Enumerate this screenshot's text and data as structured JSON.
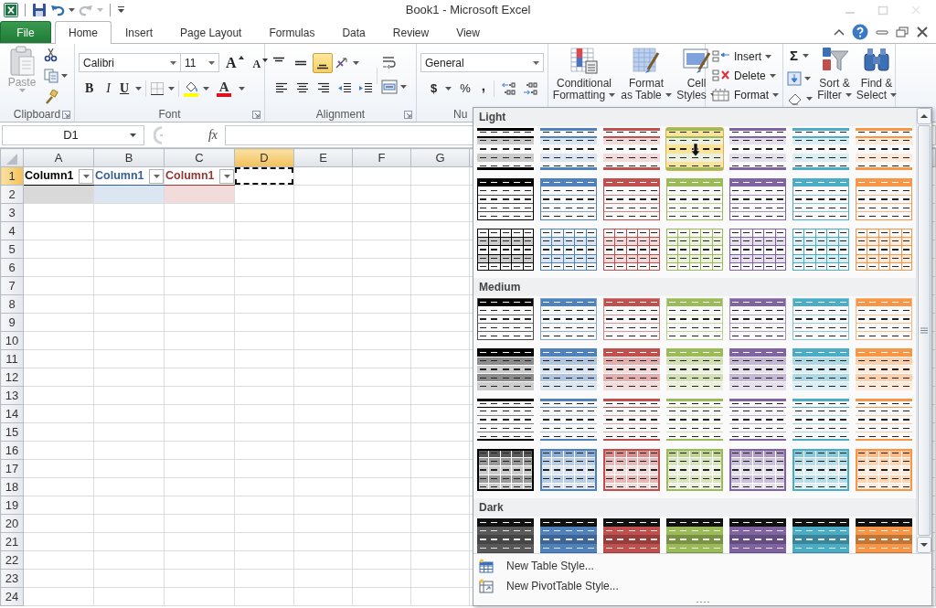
{
  "window": {
    "title": "Book1 - Microsoft Excel"
  },
  "quick_access": [
    {
      "kind": "save",
      "disabled": false
    },
    {
      "kind": "undo",
      "disabled": false
    },
    {
      "kind": "redo",
      "disabled": true
    }
  ],
  "file_tab": {
    "label": "File"
  },
  "tabs": [
    {
      "label": "Home",
      "selected": true
    },
    {
      "label": "Insert",
      "selected": false
    },
    {
      "label": "Page Layout",
      "selected": false
    },
    {
      "label": "Formulas",
      "selected": false
    },
    {
      "label": "Data",
      "selected": false
    },
    {
      "label": "Review",
      "selected": false
    },
    {
      "label": "View",
      "selected": false
    }
  ],
  "ribbon": {
    "clipboard": {
      "label": "Clipboard",
      "paste": {
        "label": "Paste",
        "disabled": true
      }
    },
    "font": {
      "label": "Font",
      "name": "Calibri",
      "size": "11",
      "grow": "A",
      "shrink": "A",
      "bold": "B",
      "italic": "I",
      "underline": "U",
      "color_letter": "A"
    },
    "alignment": {
      "label": "Alignment",
      "vertical": [
        {
          "kind": "top",
          "selected": false
        },
        {
          "kind": "middle",
          "selected": false
        },
        {
          "kind": "bottom",
          "selected": true
        }
      ]
    },
    "number": {
      "label": "Nu",
      "format": "General",
      "currency": "$",
      "percent": "%",
      "comma": ","
    },
    "styles": [
      {
        "kind": "conditional",
        "lines": [
          "Conditional",
          "Formatting"
        ]
      },
      {
        "kind": "table",
        "lines": [
          "Format",
          "as Table"
        ]
      },
      {
        "kind": "cell",
        "lines": [
          "Cell",
          "Styles"
        ]
      }
    ],
    "cells": [
      {
        "kind": "insert",
        "label": "Insert"
      },
      {
        "kind": "delete",
        "label": "Delete"
      },
      {
        "kind": "format",
        "label": "Format"
      }
    ],
    "editing": {
      "sum": "Σ",
      "buttons": [
        {
          "kind": "sort",
          "lines": [
            "Sort &",
            "Filter"
          ]
        },
        {
          "kind": "find",
          "lines": [
            "Find &",
            "Select"
          ]
        }
      ]
    }
  },
  "formula_bar": {
    "name_box": "D1",
    "fx": "fx"
  },
  "sheet": {
    "columns": [
      {
        "label": "A",
        "selected": false
      },
      {
        "label": "B",
        "selected": false
      },
      {
        "label": "C",
        "selected": false
      },
      {
        "label": "D",
        "selected": true
      },
      {
        "label": "E",
        "selected": false
      },
      {
        "label": "F",
        "selected": false
      },
      {
        "label": "G",
        "selected": false
      }
    ],
    "rows": [
      {
        "label": "1",
        "selected": true,
        "cells": [
          {
            "kind": "table-header",
            "text": "Column1",
            "color": "#000000"
          },
          {
            "kind": "table-header",
            "text": "Column1",
            "color": "#366092"
          },
          {
            "kind": "table-header",
            "text": "Column1",
            "color": "#963634"
          },
          {
            "kind": "active"
          }
        ]
      },
      {
        "label": "2",
        "selected": false,
        "cells": [
          {
            "kind": "table-body",
            "color": "#d9d9d9"
          },
          {
            "kind": "table-body",
            "color": "#dce6f1"
          },
          {
            "kind": "table-body",
            "color": "#f2dcdb"
          }
        ]
      },
      {
        "label": "3",
        "selected": false
      },
      {
        "label": "4",
        "selected": false
      },
      {
        "label": "5",
        "selected": false
      },
      {
        "label": "6",
        "selected": false
      },
      {
        "label": "7",
        "selected": false
      },
      {
        "label": "8",
        "selected": false
      },
      {
        "label": "9",
        "selected": false
      },
      {
        "label": "10",
        "selected": false
      },
      {
        "label": "11",
        "selected": false
      },
      {
        "label": "12",
        "selected": false
      },
      {
        "label": "13",
        "selected": false
      },
      {
        "label": "14",
        "selected": false
      },
      {
        "label": "15",
        "selected": false
      },
      {
        "label": "16",
        "selected": false
      },
      {
        "label": "17",
        "selected": false
      },
      {
        "label": "18",
        "selected": false
      },
      {
        "label": "19",
        "selected": false
      },
      {
        "label": "20",
        "selected": false
      },
      {
        "label": "21",
        "selected": false
      },
      {
        "label": "22",
        "selected": false
      },
      {
        "label": "23",
        "selected": false
      },
      {
        "label": "24",
        "selected": false
      }
    ]
  },
  "gallery": {
    "sections": [
      {
        "title": "Light",
        "rows": [
          {
            "kind": "light-banded",
            "items": [
              {
                "color": "#000000",
                "highlighted": false
              },
              {
                "color": "#4f81bd",
                "highlighted": false
              },
              {
                "color": "#c0504d",
                "highlighted": false
              },
              {
                "color": "#9bbb59",
                "highlighted": true
              },
              {
                "color": "#8064a2",
                "highlighted": false
              },
              {
                "color": "#4bacc6",
                "highlighted": false
              },
              {
                "color": "#f79646",
                "highlighted": false
              }
            ]
          },
          {
            "kind": "light-header",
            "items": [
              {
                "color": "#000000",
                "highlighted": false
              },
              {
                "color": "#4f81bd",
                "highlighted": false
              },
              {
                "color": "#c0504d",
                "highlighted": false
              },
              {
                "color": "#9bbb59",
                "highlighted": false
              },
              {
                "color": "#8064a2",
                "highlighted": false
              },
              {
                "color": "#4bacc6",
                "highlighted": false
              },
              {
                "color": "#f79646",
                "highlighted": false
              }
            ]
          },
          {
            "kind": "light-grid",
            "items": [
              {
                "color": "#000000",
                "highlighted": false
              },
              {
                "color": "#4f81bd",
                "highlighted": false
              },
              {
                "color": "#c0504d",
                "highlighted": false
              },
              {
                "color": "#9bbb59",
                "highlighted": false
              },
              {
                "color": "#8064a2",
                "highlighted": false
              },
              {
                "color": "#4bacc6",
                "highlighted": false
              },
              {
                "color": "#f79646",
                "highlighted": false
              }
            ]
          }
        ]
      },
      {
        "title": "Medium",
        "rows": [
          {
            "kind": "medium-lined",
            "items": [
              {
                "color": "#000000",
                "highlighted": false
              },
              {
                "color": "#4f81bd",
                "highlighted": false
              },
              {
                "color": "#c0504d",
                "highlighted": false
              },
              {
                "color": "#9bbb59",
                "highlighted": false
              },
              {
                "color": "#8064a2",
                "highlighted": false
              },
              {
                "color": "#4bacc6",
                "highlighted": false
              },
              {
                "color": "#f79646",
                "highlighted": false
              }
            ]
          },
          {
            "kind": "medium-banded",
            "items": [
              {
                "color": "#000000",
                "highlighted": false
              },
              {
                "color": "#4f81bd",
                "highlighted": false
              },
              {
                "color": "#c0504d",
                "highlighted": false
              },
              {
                "color": "#9bbb59",
                "highlighted": false
              },
              {
                "color": "#8064a2",
                "highlighted": false
              },
              {
                "color": "#4bacc6",
                "highlighted": false
              },
              {
                "color": "#f79646",
                "highlighted": false
              }
            ]
          },
          {
            "kind": "medium-ruled",
            "items": [
              {
                "color": "#000000",
                "highlighted": false
              },
              {
                "color": "#4f81bd",
                "highlighted": false
              },
              {
                "color": "#c0504d",
                "highlighted": false
              },
              {
                "color": "#9bbb59",
                "highlighted": false
              },
              {
                "color": "#8064a2",
                "highlighted": false
              },
              {
                "color": "#4bacc6",
                "highlighted": false
              },
              {
                "color": "#f79646",
                "highlighted": false
              }
            ]
          },
          {
            "kind": "medium-grid",
            "items": [
              {
                "color": "#000000",
                "highlighted": false
              },
              {
                "color": "#4f81bd",
                "highlighted": false
              },
              {
                "color": "#c0504d",
                "highlighted": false
              },
              {
                "color": "#9bbb59",
                "highlighted": false
              },
              {
                "color": "#8064a2",
                "highlighted": false
              },
              {
                "color": "#4bacc6",
                "highlighted": false
              },
              {
                "color": "#f79646",
                "highlighted": false
              }
            ]
          }
        ]
      },
      {
        "title": "Dark",
        "rows": [
          {
            "kind": "dark-banded",
            "items": [
              {
                "color": "#595959",
                "highlighted": false
              },
              {
                "color": "#4f81bd",
                "highlighted": false
              },
              {
                "color": "#c0504d",
                "highlighted": false
              },
              {
                "color": "#9bbb59",
                "highlighted": false
              },
              {
                "color": "#8064a2",
                "highlighted": false
              },
              {
                "color": "#4bacc6",
                "highlighted": false
              },
              {
                "color": "#f79646",
                "highlighted": false
              }
            ]
          }
        ]
      }
    ],
    "footer": [
      {
        "kind": "table",
        "label": "New Table Style..."
      },
      {
        "kind": "pivot",
        "label": "New PivotTable Style..."
      }
    ]
  }
}
